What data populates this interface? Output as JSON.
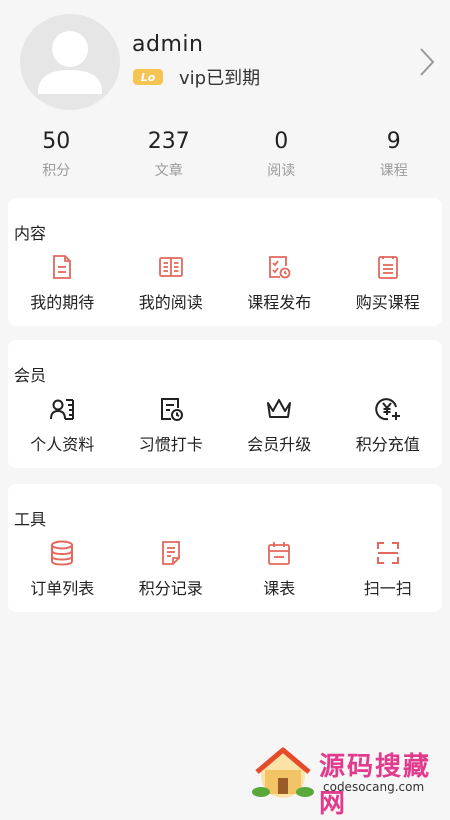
{
  "profile": {
    "username": "admin",
    "vip_badge": "Lo",
    "vip_status": "vip已到期"
  },
  "stats": [
    {
      "value": "50",
      "label": "积分"
    },
    {
      "value": "237",
      "label": "文章"
    },
    {
      "value": "0",
      "label": "阅读"
    },
    {
      "value": "9",
      "label": "课程"
    }
  ],
  "sections": {
    "content": {
      "title": "内容",
      "items": [
        {
          "label": "我的期待",
          "icon": "document-icon"
        },
        {
          "label": "我的阅读",
          "icon": "open-book-icon"
        },
        {
          "label": "课程发布",
          "icon": "checklist-clock-icon"
        },
        {
          "label": "购买课程",
          "icon": "list-doc-icon"
        }
      ]
    },
    "member": {
      "title": "会员",
      "items": [
        {
          "label": "个人资料",
          "icon": "profile-card-icon"
        },
        {
          "label": "习惯打卡",
          "icon": "clock-document-icon"
        },
        {
          "label": "会员升级",
          "icon": "crown-icon"
        },
        {
          "label": "积分充值",
          "icon": "yen-plus-icon"
        }
      ]
    },
    "tools": {
      "title": "工具",
      "items": [
        {
          "label": "订单列表",
          "icon": "database-icon"
        },
        {
          "label": "积分记录",
          "icon": "record-doc-icon"
        },
        {
          "label": "课表",
          "icon": "calendar-icon"
        },
        {
          "label": "扫一扫",
          "icon": "scan-icon"
        }
      ]
    }
  },
  "watermark": {
    "title": "源码搜藏网",
    "url": "codesocang.com"
  },
  "colors": {
    "accent": "#e4685c",
    "dark_icon": "#222222",
    "background": "#f6f6f6",
    "vip_gold": "#f6c453"
  }
}
